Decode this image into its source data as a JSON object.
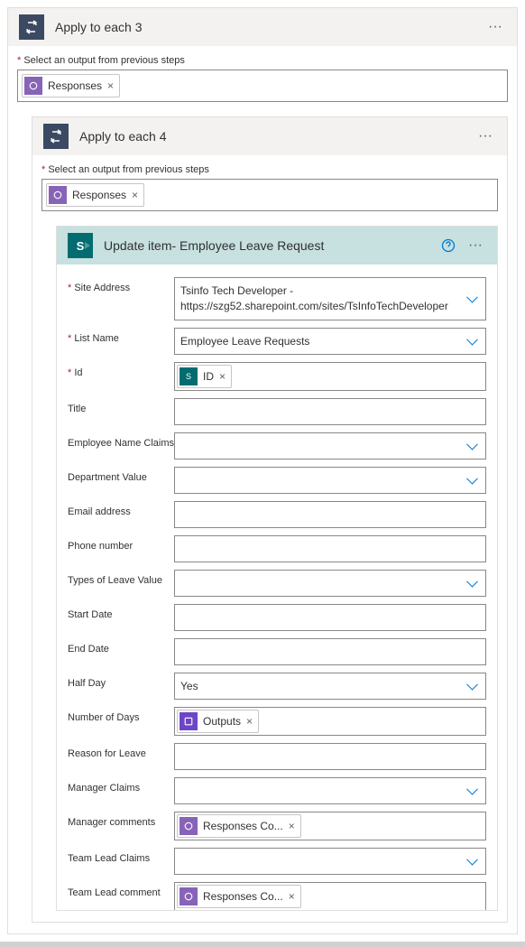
{
  "outer": {
    "title": "Apply to each 3",
    "outputLabel": "Select an output from previous steps",
    "tokenLabel": "Responses"
  },
  "inner": {
    "title": "Apply to each 4",
    "outputLabel": "Select an output from previous steps",
    "tokenLabel": "Responses"
  },
  "action": {
    "iconLetter": "S",
    "title": "Update item- Employee Leave Request",
    "fields": {
      "siteAddress": {
        "label": "Site Address",
        "line1": "Tsinfo Tech Developer -",
        "line2": "https://szg52.sharepoint.com/sites/TsInfoTechDeveloper"
      },
      "listName": {
        "label": "List Name",
        "value": "Employee Leave Requests"
      },
      "id": {
        "label": "Id",
        "token": "ID"
      },
      "title": {
        "label": "Title"
      },
      "empClaims": {
        "label": "Employee Name Claims"
      },
      "deptValue": {
        "label": "Department Value"
      },
      "email": {
        "label": "Email address"
      },
      "phone": {
        "label": "Phone number"
      },
      "leaveType": {
        "label": "Types of Leave Value"
      },
      "startDate": {
        "label": "Start Date"
      },
      "endDate": {
        "label": "End Date"
      },
      "halfDay": {
        "label": "Half Day",
        "value": "Yes"
      },
      "numDays": {
        "label": "Number of Days",
        "token": "Outputs"
      },
      "reason": {
        "label": "Reason for Leave"
      },
      "mgrClaims": {
        "label": "Manager Claims"
      },
      "mgrComments": {
        "label": "Manager comments",
        "token": "Responses Co..."
      },
      "tlClaims": {
        "label": "Team Lead Claims"
      },
      "tlComment": {
        "label": "Team Lead comment",
        "token": "Responses Co..."
      }
    }
  }
}
